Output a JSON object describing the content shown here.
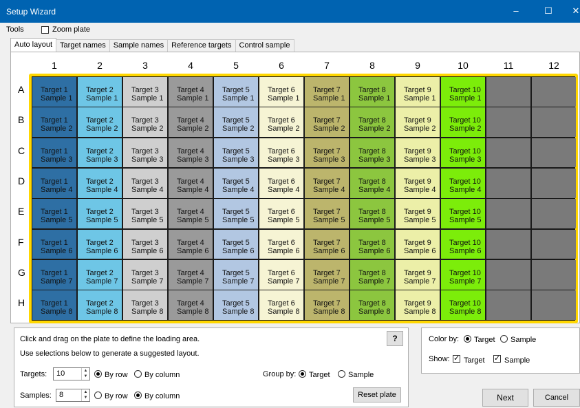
{
  "window": {
    "title": "Setup Wizard",
    "minimize": "–",
    "maximize": "☐",
    "close": "✕"
  },
  "menu": {
    "tools": "Tools",
    "zoom_plate": "Zoom plate"
  },
  "tabs": [
    "Auto layout",
    "Target names",
    "Sample names",
    "Reference targets",
    "Control sample"
  ],
  "plate": {
    "columns": [
      "1",
      "2",
      "3",
      "4",
      "5",
      "6",
      "7",
      "8",
      "9",
      "10",
      "11",
      "12"
    ],
    "rows": [
      "A",
      "B",
      "C",
      "D",
      "E",
      "F",
      "G",
      "H"
    ],
    "target_colors": [
      "#2e6fa4",
      "#6ec6e6",
      "#cfcfcf",
      "#9a9a9a",
      "#b2c7e2",
      "#f6f4d4",
      "#bcb56c",
      "#8cc63f",
      "#ecefa8",
      "#7ced0a"
    ],
    "empty_color": "#7a7a7a",
    "border_color": "#ffd700",
    "wells": [
      [
        [
          "Target 1",
          "Sample 1"
        ],
        [
          "Target 2",
          "Sample 1"
        ],
        [
          "Target 3",
          "Sample 1"
        ],
        [
          "Target 4",
          "Sample 1"
        ],
        [
          "Target 5",
          "Sample 1"
        ],
        [
          "Target 6",
          "Sample 1"
        ],
        [
          "Target 7",
          "Sample 1"
        ],
        [
          "Target 8",
          "Sample 1"
        ],
        [
          "Target 9",
          "Sample 1"
        ],
        [
          "Target 10",
          "Sample 1"
        ]
      ],
      [
        [
          "Target 1",
          "Sample 2"
        ],
        [
          "Target 2",
          "Sample 2"
        ],
        [
          "Target 3",
          "Sample 2"
        ],
        [
          "Target 4",
          "Sample 2"
        ],
        [
          "Target 5",
          "Sample 2"
        ],
        [
          "Target 6",
          "Sample 2"
        ],
        [
          "Target 7",
          "Sample 2"
        ],
        [
          "Target 8",
          "Sample 2"
        ],
        [
          "Target 9",
          "Sample 2"
        ],
        [
          "Target 10",
          "Sample 2"
        ]
      ],
      [
        [
          "Target 1",
          "Sample 3"
        ],
        [
          "Target 2",
          "Sample 3"
        ],
        [
          "Target 3",
          "Sample 3"
        ],
        [
          "Target 4",
          "Sample 3"
        ],
        [
          "Target 5",
          "Sample 3"
        ],
        [
          "Target 6",
          "Sample 3"
        ],
        [
          "Target 7",
          "Sample 3"
        ],
        [
          "Target 8",
          "Sample 3"
        ],
        [
          "Target 9",
          "Sample 3"
        ],
        [
          "Target 10",
          "Sample 3"
        ]
      ],
      [
        [
          "Target 1",
          "Sample 4"
        ],
        [
          "Target 2",
          "Sample 4"
        ],
        [
          "Target 3",
          "Sample 4"
        ],
        [
          "Target 4",
          "Sample 4"
        ],
        [
          "Target 5",
          "Sample 4"
        ],
        [
          "Target 6",
          "Sample 4"
        ],
        [
          "Target 7",
          "Sample 4"
        ],
        [
          "Target 8",
          "Sample 4"
        ],
        [
          "Target 9",
          "Sample 4"
        ],
        [
          "Target 10",
          "Sample 4"
        ]
      ],
      [
        [
          "Target 1",
          "Sample 5"
        ],
        [
          "Target 2",
          "Sample 5"
        ],
        [
          "Target 3",
          "Sample 5"
        ],
        [
          "Target 4",
          "Sample 5"
        ],
        [
          "Target 5",
          "Sample 5"
        ],
        [
          "Target 6",
          "Sample 5"
        ],
        [
          "Target 7",
          "Sample 5"
        ],
        [
          "Target 8",
          "Sample 5"
        ],
        [
          "Target 9",
          "Sample 5"
        ],
        [
          "Target 10",
          "Sample 5"
        ]
      ],
      [
        [
          "Target 1",
          "Sample 6"
        ],
        [
          "Target 2",
          "Sample 6"
        ],
        [
          "Target 3",
          "Sample 6"
        ],
        [
          "Target 4",
          "Sample 6"
        ],
        [
          "Target 5",
          "Sample 6"
        ],
        [
          "Target 6",
          "Sample 6"
        ],
        [
          "Target 7",
          "Sample 6"
        ],
        [
          "Target 8",
          "Sample 6"
        ],
        [
          "Target 9",
          "Sample 6"
        ],
        [
          "Target 10",
          "Sample 6"
        ]
      ],
      [
        [
          "Target 1",
          "Sample 7"
        ],
        [
          "Target 2",
          "Sample 7"
        ],
        [
          "Target 3",
          "Sample 7"
        ],
        [
          "Target 4",
          "Sample 7"
        ],
        [
          "Target 5",
          "Sample 7"
        ],
        [
          "Target 6",
          "Sample 7"
        ],
        [
          "Target 7",
          "Sample 7"
        ],
        [
          "Target 8",
          "Sample 7"
        ],
        [
          "Target 9",
          "Sample 7"
        ],
        [
          "Target 10",
          "Sample 7"
        ]
      ],
      [
        [
          "Target 1",
          "Sample 8"
        ],
        [
          "Target 2",
          "Sample 8"
        ],
        [
          "Target 3",
          "Sample 8"
        ],
        [
          "Target 4",
          "Sample 8"
        ],
        [
          "Target 5",
          "Sample 8"
        ],
        [
          "Target 6",
          "Sample 8"
        ],
        [
          "Target 7",
          "Sample 8"
        ],
        [
          "Target 8",
          "Sample 8"
        ],
        [
          "Target 9",
          "Sample 8"
        ],
        [
          "Target 10",
          "Sample 8"
        ]
      ]
    ]
  },
  "layout": {
    "instruction1": "Click and drag on the plate to define the loading area.",
    "instruction2": "Use selections below to generate a suggested layout.",
    "help": "?",
    "targets_label": "Targets:",
    "targets_value": "10",
    "samples_label": "Samples:",
    "samples_value": "8",
    "by_row": "By row",
    "by_column": "By column",
    "group_by_label": "Group by:",
    "group_target": "Target",
    "group_sample": "Sample",
    "reset_plate": "Reset plate"
  },
  "display": {
    "color_by_label": "Color by:",
    "color_target": "Target",
    "color_sample": "Sample",
    "show_label": "Show:",
    "show_target": "Target",
    "show_sample": "Sample"
  },
  "nav": {
    "next": "Next",
    "cancel": "Cancel"
  }
}
